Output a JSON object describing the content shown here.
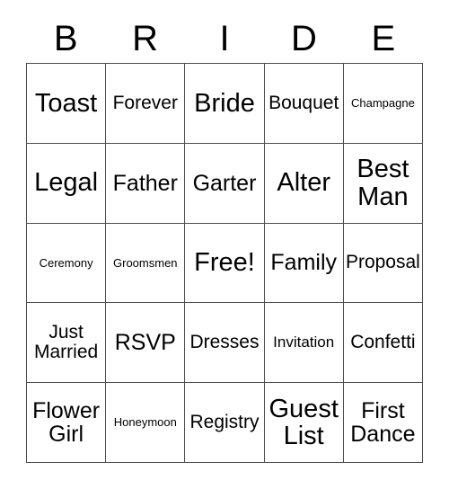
{
  "card": {
    "title_letters": [
      "B",
      "R",
      "I",
      "D",
      "E"
    ],
    "columns": 5,
    "rows": 5,
    "border_color": "#4d4d4d",
    "background_color": "#ffffff",
    "text_color": "#000000",
    "free_space_label": "Free!",
    "cells": [
      {
        "label": "Toast",
        "size": "xl"
      },
      {
        "label": "Forever",
        "size": "md"
      },
      {
        "label": "Bride",
        "size": "xl"
      },
      {
        "label": "Bouquet",
        "size": "md"
      },
      {
        "label": "Champagne",
        "size": "xs"
      },
      {
        "label": "Legal",
        "size": "xl"
      },
      {
        "label": "Father",
        "size": "lg"
      },
      {
        "label": "Garter",
        "size": "lg"
      },
      {
        "label": "Alter",
        "size": "xl"
      },
      {
        "label": "Best\nMan",
        "size": "xl"
      },
      {
        "label": "Ceremony",
        "size": "xs"
      },
      {
        "label": "Groomsmen",
        "size": "xs"
      },
      {
        "label": "Free!",
        "size": "xl"
      },
      {
        "label": "Family",
        "size": "lg"
      },
      {
        "label": "Proposal",
        "size": "md"
      },
      {
        "label": "Just\nMarried",
        "size": "md"
      },
      {
        "label": "RSVP",
        "size": "lg"
      },
      {
        "label": "Dresses",
        "size": "md"
      },
      {
        "label": "Invitation",
        "size": "sm"
      },
      {
        "label": "Confetti",
        "size": "md"
      },
      {
        "label": "Flower\nGirl",
        "size": "lg"
      },
      {
        "label": "Honeymoon",
        "size": "xs"
      },
      {
        "label": "Registry",
        "size": "md"
      },
      {
        "label": "Guest\nList",
        "size": "xl"
      },
      {
        "label": "First\nDance",
        "size": "lg"
      }
    ]
  }
}
